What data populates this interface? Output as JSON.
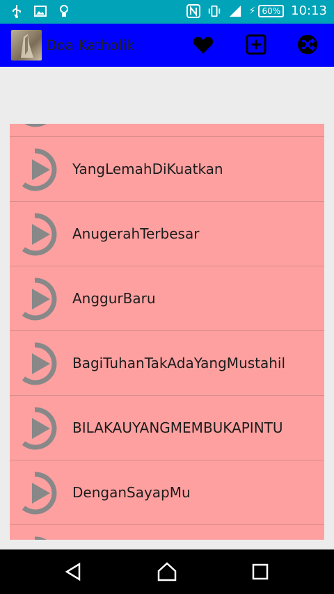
{
  "status_bar": {
    "battery": "60%",
    "time": "10:13"
  },
  "app_bar": {
    "title": "Doa Katholik"
  },
  "songs": [
    "YangLemahDiKuatkan",
    "AnugerahTerbesar",
    "AnggurBaru",
    "BagiTuhanTakAdaYangMustahil",
    "BILAKAUYANGMEMBUKAPINTU",
    "DenganSayapMu"
  ],
  "colors": {
    "status_bar": "#00a3b8",
    "app_bar": "#0000ff",
    "list_bg": "#ffa0a0",
    "page_bg": "#ececec"
  }
}
